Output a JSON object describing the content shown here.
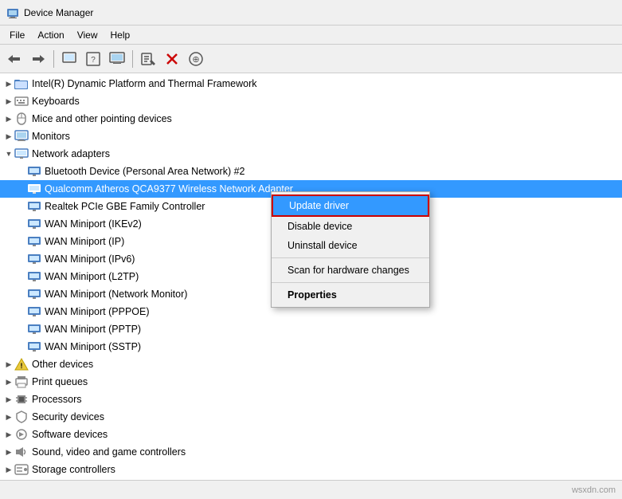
{
  "titleBar": {
    "title": "Device Manager",
    "icon": "computer"
  },
  "menuBar": {
    "items": [
      "File",
      "Action",
      "View",
      "Help"
    ]
  },
  "toolbar": {
    "buttons": [
      {
        "name": "back",
        "icon": "◀",
        "label": "Back"
      },
      {
        "name": "forward",
        "icon": "▶",
        "label": "Forward"
      },
      {
        "name": "sep1",
        "type": "separator"
      },
      {
        "name": "properties",
        "icon": "🗔",
        "label": "Properties"
      },
      {
        "name": "update-driver",
        "icon": "📋",
        "label": "Update driver"
      },
      {
        "name": "help",
        "icon": "?",
        "label": "Help"
      },
      {
        "name": "display",
        "icon": "🖥",
        "label": "Display"
      },
      {
        "name": "sep2",
        "type": "separator"
      },
      {
        "name": "scan",
        "icon": "🔍",
        "label": "Scan for hardware changes"
      },
      {
        "name": "remove",
        "icon": "✕",
        "label": "Remove"
      },
      {
        "name": "download",
        "icon": "⊕",
        "label": "Download"
      }
    ]
  },
  "treeItems": [
    {
      "id": "intel",
      "label": "Intel(R) Dynamic Platform and Thermal Framework",
      "indent": 1,
      "toggle": "►",
      "icon": "folder",
      "selected": false
    },
    {
      "id": "keyboards",
      "label": "Keyboards",
      "indent": 1,
      "toggle": "►",
      "icon": "keyboard",
      "selected": false
    },
    {
      "id": "mice",
      "label": "Mice and other pointing devices",
      "indent": 1,
      "toggle": "►",
      "icon": "mouse",
      "selected": false
    },
    {
      "id": "monitors",
      "label": "Monitors",
      "indent": 1,
      "toggle": "►",
      "icon": "monitor",
      "selected": false
    },
    {
      "id": "network-adapters",
      "label": "Network adapters",
      "indent": 1,
      "toggle": "▼",
      "icon": "network",
      "selected": false,
      "expanded": true
    },
    {
      "id": "bluetooth",
      "label": "Bluetooth Device (Personal Area Network) #2",
      "indent": 2,
      "toggle": "",
      "icon": "net",
      "selected": false
    },
    {
      "id": "qualcomm",
      "label": "Qualcomm Atheros QCA9377 Wireless Network Adapter",
      "indent": 2,
      "toggle": "",
      "icon": "net",
      "selected": true,
      "contextSelected": true
    },
    {
      "id": "realtek",
      "label": "Realtek PCIe GBE Family Controller",
      "indent": 2,
      "toggle": "",
      "icon": "net",
      "selected": false
    },
    {
      "id": "wan-ikev2",
      "label": "WAN Miniport (IKEv2)",
      "indent": 2,
      "toggle": "",
      "icon": "net",
      "selected": false
    },
    {
      "id": "wan-ip",
      "label": "WAN Miniport (IP)",
      "indent": 2,
      "toggle": "",
      "icon": "net",
      "selected": false
    },
    {
      "id": "wan-ipv6",
      "label": "WAN Miniport (IPv6)",
      "indent": 2,
      "toggle": "",
      "icon": "net",
      "selected": false
    },
    {
      "id": "wan-l2tp",
      "label": "WAN Miniport (L2TP)",
      "indent": 2,
      "toggle": "",
      "icon": "net",
      "selected": false
    },
    {
      "id": "wan-nm",
      "label": "WAN Miniport (Network Monitor)",
      "indent": 2,
      "toggle": "",
      "icon": "net",
      "selected": false
    },
    {
      "id": "wan-pppoe",
      "label": "WAN Miniport (PPPOE)",
      "indent": 2,
      "toggle": "",
      "icon": "net",
      "selected": false
    },
    {
      "id": "wan-pptp",
      "label": "WAN Miniport (PPTP)",
      "indent": 2,
      "toggle": "",
      "icon": "net",
      "selected": false
    },
    {
      "id": "wan-sstp",
      "label": "WAN Miniport (SSTP)",
      "indent": 2,
      "toggle": "",
      "icon": "net",
      "selected": false
    },
    {
      "id": "other-devices",
      "label": "Other devices",
      "indent": 1,
      "toggle": "►",
      "icon": "warn",
      "selected": false
    },
    {
      "id": "print-queues",
      "label": "Print queues",
      "indent": 1,
      "toggle": "►",
      "icon": "printer",
      "selected": false
    },
    {
      "id": "processors",
      "label": "Processors",
      "indent": 1,
      "toggle": "►",
      "icon": "chip",
      "selected": false
    },
    {
      "id": "security-devices",
      "label": "Security devices",
      "indent": 1,
      "toggle": "►",
      "icon": "security",
      "selected": false
    },
    {
      "id": "software-devices",
      "label": "Software devices",
      "indent": 1,
      "toggle": "►",
      "icon": "software",
      "selected": false
    },
    {
      "id": "sound",
      "label": "Sound, video and game controllers",
      "indent": 1,
      "toggle": "►",
      "icon": "sound",
      "selected": false
    },
    {
      "id": "storage",
      "label": "Storage controllers",
      "indent": 1,
      "toggle": "►",
      "icon": "storage",
      "selected": false
    }
  ],
  "contextMenu": {
    "items": [
      {
        "id": "update-driver",
        "label": "Update driver",
        "type": "highlighted"
      },
      {
        "id": "disable-device",
        "label": "Disable device",
        "type": "normal"
      },
      {
        "id": "uninstall-device",
        "label": "Uninstall device",
        "type": "normal"
      },
      {
        "id": "sep1",
        "type": "separator"
      },
      {
        "id": "scan-hardware",
        "label": "Scan for hardware changes",
        "type": "normal"
      },
      {
        "id": "sep2",
        "type": "separator"
      },
      {
        "id": "properties",
        "label": "Properties",
        "type": "bold"
      }
    ]
  },
  "statusBar": {
    "text": ""
  },
  "watermark": "wsxdn.com"
}
